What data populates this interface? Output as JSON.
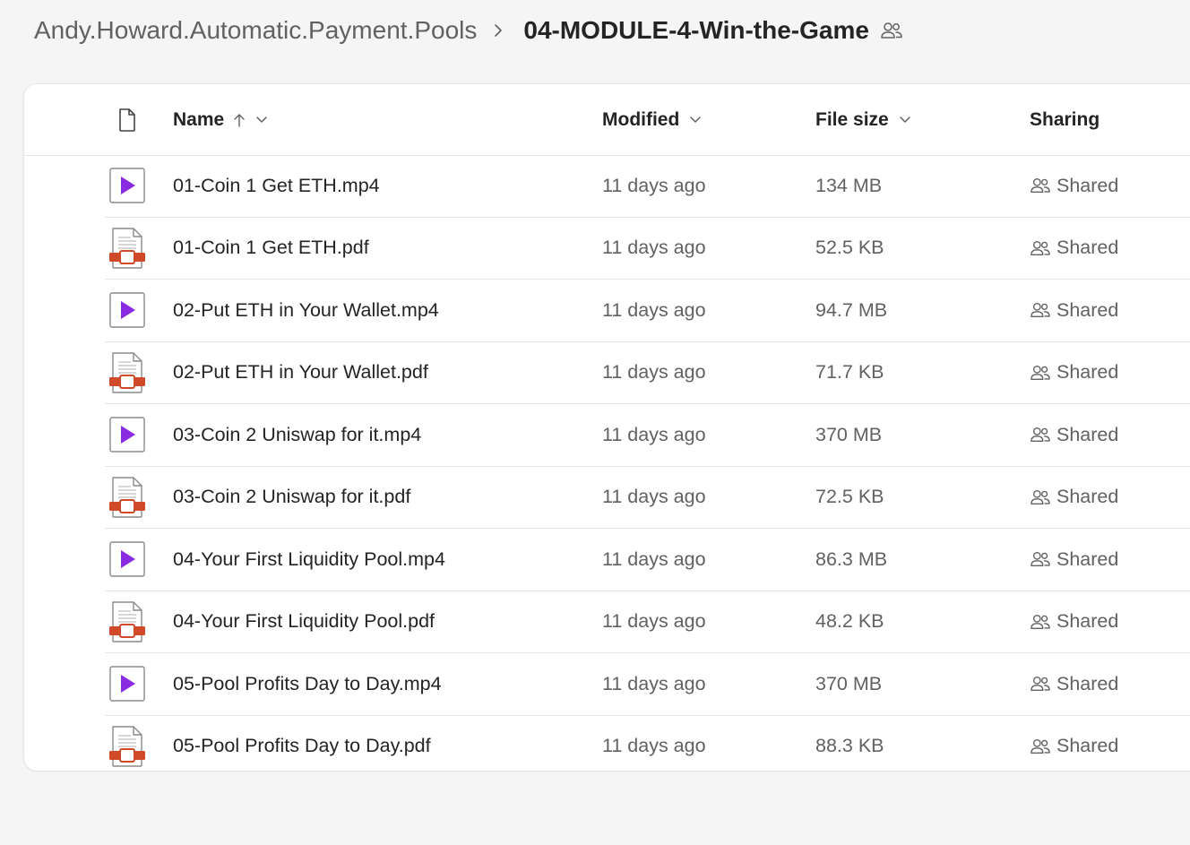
{
  "breadcrumb": {
    "parent": "Andy.Howard.Automatic.Payment.Pools",
    "current": "04-MODULE-4-Win-the-Game"
  },
  "columns": {
    "name": "Name",
    "modified": "Modified",
    "size": "File size",
    "sharing": "Sharing"
  },
  "colors": {
    "video_play": "#8a2be2",
    "pdf_accent": "#d04a2a",
    "text_primary": "#242424",
    "text_secondary": "#616161"
  },
  "icons": {
    "file_header": "document-icon",
    "video": "video-file-icon",
    "pdf": "pdf-file-icon",
    "shared": "people-icon",
    "sort": "arrow-up-icon",
    "dropdown": "chevron-down-icon"
  },
  "files": [
    {
      "name": "01-Coin 1 Get ETH.mp4",
      "type": "video",
      "modified": "11 days ago",
      "size": "134 MB",
      "sharing": "Shared"
    },
    {
      "name": "01-Coin 1 Get ETH.pdf",
      "type": "pdf",
      "modified": "11 days ago",
      "size": "52.5 KB",
      "sharing": "Shared"
    },
    {
      "name": "02-Put ETH in Your Wallet.mp4",
      "type": "video",
      "modified": "11 days ago",
      "size": "94.7 MB",
      "sharing": "Shared"
    },
    {
      "name": "02-Put ETH in Your Wallet.pdf",
      "type": "pdf",
      "modified": "11 days ago",
      "size": "71.7 KB",
      "sharing": "Shared"
    },
    {
      "name": "03-Coin 2 Uniswap for it.mp4",
      "type": "video",
      "modified": "11 days ago",
      "size": "370 MB",
      "sharing": "Shared"
    },
    {
      "name": "03-Coin 2 Uniswap for it.pdf",
      "type": "pdf",
      "modified": "11 days ago",
      "size": "72.5 KB",
      "sharing": "Shared"
    },
    {
      "name": "04-Your First Liquidity Pool.mp4",
      "type": "video",
      "modified": "11 days ago",
      "size": "86.3 MB",
      "sharing": "Shared"
    },
    {
      "name": "04-Your First Liquidity Pool.pdf",
      "type": "pdf",
      "modified": "11 days ago",
      "size": "48.2 KB",
      "sharing": "Shared"
    },
    {
      "name": "05-Pool Profits Day to Day.mp4",
      "type": "video",
      "modified": "11 days ago",
      "size": "370 MB",
      "sharing": "Shared"
    },
    {
      "name": "05-Pool Profits Day to Day.pdf",
      "type": "pdf",
      "modified": "11 days ago",
      "size": "88.3 KB",
      "sharing": "Shared"
    }
  ]
}
